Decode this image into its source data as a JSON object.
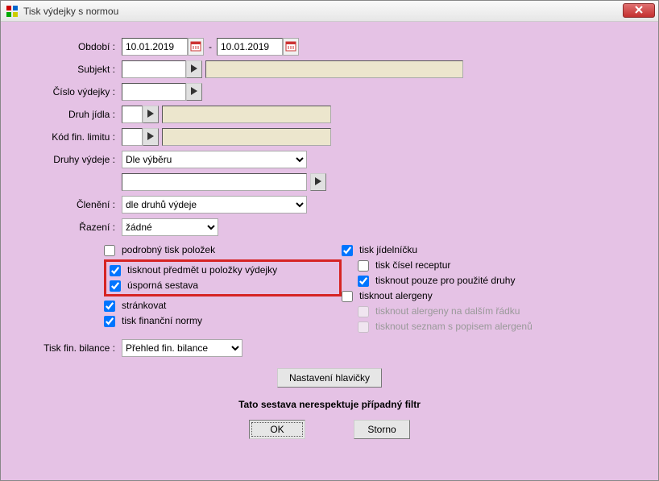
{
  "window": {
    "title": "Tisk výdejky s normou"
  },
  "labels": {
    "obdobi": "Období :",
    "subjekt": "Subjekt :",
    "cislo_vydejky": "Číslo výdejky :",
    "druh_jidla": "Druh jídla :",
    "kod_fin_limitu": "Kód fin. limitu :",
    "druhy_vydeje": "Druhy výdeje :",
    "cleneni": "Členění :",
    "razeni": "Řazení :",
    "tisk_fin_bilance": "Tisk fin. bilance :",
    "dash": "-"
  },
  "fields": {
    "date_from": "10.01.2019",
    "date_to": "10.01.2019",
    "subjekt": "",
    "subjekt_display": "",
    "cislo_vydejky": "",
    "druh_jidla_code": "",
    "druh_jidla_display": "",
    "kod_fin_code": "",
    "kod_fin_display": "",
    "druhy_vydeje": "Dle výběru",
    "druhy_vydeje_text": "",
    "cleneni": "dle druhů výdeje",
    "razeni": "žádné",
    "tisk_fin_bilance": "Přehled fin. bilance"
  },
  "checkboxes_left": {
    "podrobny_tisk": {
      "label": "podrobný tisk položek",
      "checked": false
    },
    "tisknout_predmet": {
      "label": "tisknout předmět u položky výdejky",
      "checked": true
    },
    "usporna_sestava": {
      "label": "úsporná sestava",
      "checked": true
    },
    "strankovat": {
      "label": "stránkovat",
      "checked": true
    },
    "tisk_fin_normy": {
      "label": "tisk finanční normy",
      "checked": true
    }
  },
  "checkboxes_right": {
    "tisk_jidelnicku": {
      "label": "tisk jídelníčku",
      "checked": true
    },
    "tisk_cisel_receptur": {
      "label": "tisk čísel receptur",
      "checked": false
    },
    "tisknout_pouze_druhy": {
      "label": "tisknout pouze pro použité druhy",
      "checked": true
    },
    "tisknout_alergeny": {
      "label": "tisknout alergeny",
      "checked": false
    },
    "tisknout_alergeny_radek": {
      "label": "tisknout alergeny na dalším řádku",
      "checked": false
    },
    "tisknout_seznam_alergenu": {
      "label": "tisknout seznam s popisem alergenů",
      "checked": false
    }
  },
  "buttons": {
    "nastaveni_hlavicky": "Nastavení hlavičky",
    "ok": "OK",
    "storno": "Storno"
  },
  "footer": "Tato sestava nerespektuje případný filtr"
}
